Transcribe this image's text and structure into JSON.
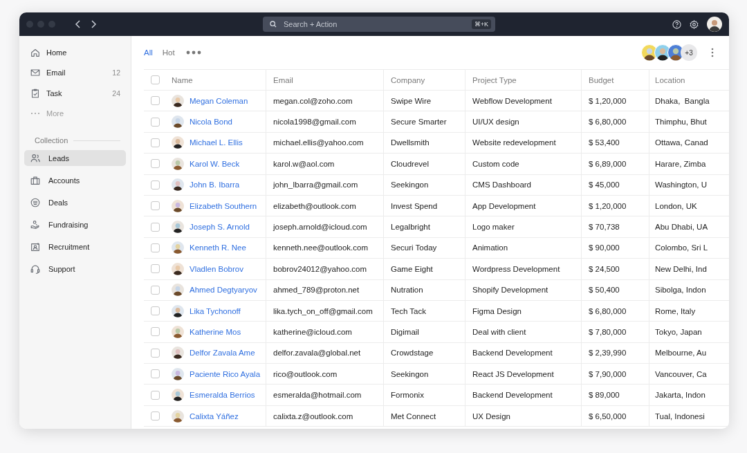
{
  "titlebar": {
    "search": {
      "placeholder": "Search + Action",
      "shortcut": "⌘+K"
    }
  },
  "sidebar": {
    "items": [
      {
        "label": "Home",
        "kind": "link"
      },
      {
        "label": "Email",
        "count": "12",
        "kind": "link"
      },
      {
        "label": "Task",
        "count": "24",
        "kind": "link"
      },
      {
        "label": "More",
        "kind": "more"
      }
    ],
    "section": "Collection",
    "collection": [
      {
        "label": "Leads",
        "selected": true
      },
      {
        "label": "Accounts",
        "selected": false
      },
      {
        "label": "Deals",
        "selected": false
      },
      {
        "label": "Fundraising",
        "selected": false
      },
      {
        "label": "Recruitment",
        "selected": false
      },
      {
        "label": "Support",
        "selected": false
      }
    ]
  },
  "tabs": [
    {
      "label": "All",
      "selected": true
    },
    {
      "label": "Hot",
      "selected": false
    }
  ],
  "team": {
    "extra": "+3"
  },
  "table": {
    "header_checked": false,
    "columns": [
      "Name",
      "Email",
      "Company",
      "Project Type",
      "Budget",
      "Location"
    ],
    "rows": [
      {
        "checked": false,
        "name": "Megan Coleman",
        "email": "megan.col@zoho.com",
        "company": "Swipe Wire",
        "project_type": "Webflow Development",
        "budget": "$ 1,20,000",
        "location": "Dhaka,  Bangla"
      },
      {
        "checked": false,
        "name": "Nicola Bond",
        "email": "nicola1998@gmail.com",
        "company": "Secure Smarter",
        "project_type": "UI/UX design",
        "budget": "$ 6,80,000",
        "location": "Thimphu, Bhut"
      },
      {
        "checked": false,
        "name": "Michael L. Ellis",
        "email": "michael.ellis@yahoo.com",
        "company": "Dwellsmith",
        "project_type": "Website redevelopment",
        "budget": "$ 53,400",
        "location": "Ottawa, Canad"
      },
      {
        "checked": false,
        "name": "Karol W. Beck",
        "email": "karol.w@aol.com",
        "company": "Cloudrevel",
        "project_type": "Custom code",
        "budget": "$ 6,89,000",
        "location": "Harare, Zimba"
      },
      {
        "checked": false,
        "name": "John B. Ibarra",
        "email": "john_Ibarra@gmail.com",
        "company": "Seekingon",
        "project_type": "CMS Dashboard",
        "budget": "$ 45,000",
        "location": "Washington, U"
      },
      {
        "checked": false,
        "name": "Elizabeth Southern",
        "email": "elizabeth@outlook.com",
        "company": "Invest Spend",
        "project_type": "App Development",
        "budget": "$ 1,20,000",
        "location": "London, UK"
      },
      {
        "checked": false,
        "name": "Joseph S. Arnold",
        "email": "joseph.arnold@icloud.com",
        "company": "Legalbright",
        "project_type": "Logo maker",
        "budget": "$ 70,738",
        "location": "Abu Dhabi, UA"
      },
      {
        "checked": false,
        "name": "Kenneth R. Nee",
        "email": "kenneth.nee@outlook.com",
        "company": "Securi Today",
        "project_type": "Animation",
        "budget": "$ 90,000",
        "location": "Colombo, Sri L"
      },
      {
        "checked": false,
        "name": "Vladlen Bobrov",
        "email": "bobrov24012@yahoo.com",
        "company": "Game Eight",
        "project_type": "Wordpress Development",
        "budget": "$ 24,500",
        "location": "New Delhi, Ind"
      },
      {
        "checked": false,
        "name": "Ahmed Degtyaryov",
        "email": "ahmed_789@proton.net",
        "company": "Nutration",
        "project_type": "Shopify Development",
        "budget": "$ 50,400",
        "location": "Sibolga, Indon"
      },
      {
        "checked": false,
        "name": "Lika Tychonoff",
        "email": "lika.tych_on_off@gmail.com",
        "company": "Tech Tack",
        "project_type": "Figma Design",
        "budget": "$ 6,80,000",
        "location": "Rome, Italy"
      },
      {
        "checked": false,
        "name": "Katherine Mos",
        "email": "katherine@icloud.com",
        "company": "Digimail",
        "project_type": "Deal with client",
        "budget": "$ 7,80,000",
        "location": "Tokyo, Japan"
      },
      {
        "checked": false,
        "name": "Delfor Zavala Ame",
        "email": "delfor.zavala@global.net",
        "company": "Crowdstage",
        "project_type": "Backend Development",
        "budget": "$ 2,39,990",
        "location": "Melbourne, Au"
      },
      {
        "checked": false,
        "name": "Paciente Rico Ayala",
        "email": "rico@outlook.com",
        "company": "Seekingon",
        "project_type": "React JS Development",
        "budget": "$ 7,90,000",
        "location": "Vancouver, Ca"
      },
      {
        "checked": false,
        "name": "Esmeralda Berrios",
        "email": "esmeralda@hotmail.com",
        "company": "Formonix",
        "project_type": "Backend Development",
        "budget": "$ 89,000",
        "location": "Jakarta, Indon"
      },
      {
        "checked": false,
        "name": "Calixta Yáñez",
        "email": "calixta.z@outlook.com",
        "company": "Met Connect",
        "project_type": "UX Design",
        "budget": "$ 6,50,000",
        "location": "Tual, Indonesi"
      }
    ]
  }
}
